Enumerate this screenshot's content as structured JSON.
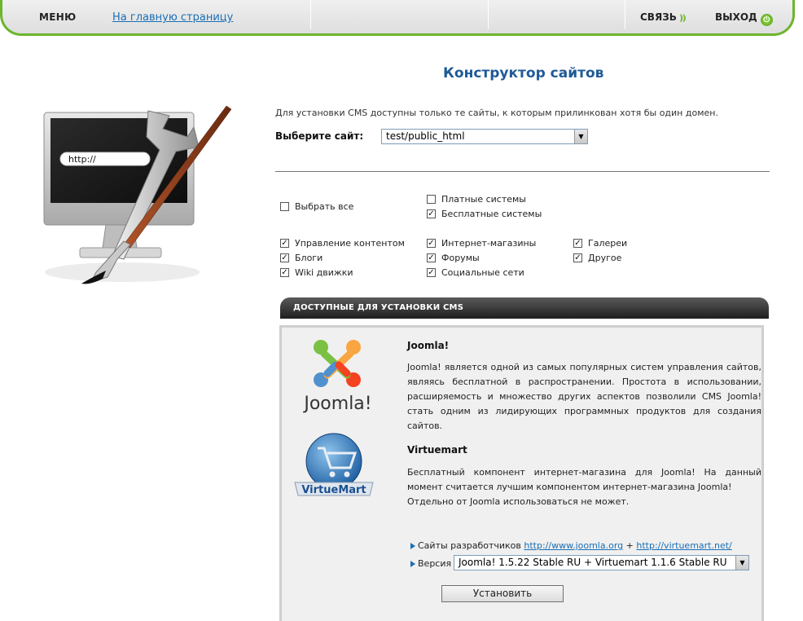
{
  "topbar": {
    "menu_label": "МЕНЮ",
    "home_link": "На главную страницу",
    "contact_label": "СВЯЗЬ",
    "logout_label": "ВЫХОД"
  },
  "page": {
    "title": "Конструктор сайтов",
    "illustration_text": "http://"
  },
  "site_select": {
    "note": "Для установки CMS доступны только те сайты, к которым прилинкован хотя бы один домен.",
    "label": "Выберите сайт:",
    "selected": "test/public_html"
  },
  "filters": {
    "select_all": {
      "label": "Выбрать все",
      "checked": false
    },
    "paid": {
      "label": "Платные системы",
      "checked": false
    },
    "free": {
      "label": "Бесплатные системы",
      "checked": true
    },
    "categories": [
      {
        "label": "Управление контентом",
        "checked": true
      },
      {
        "label": "Блоги",
        "checked": true
      },
      {
        "label": "Wiki движки",
        "checked": true
      },
      {
        "label": "Интернет-магазины",
        "checked": true
      },
      {
        "label": "Форумы",
        "checked": true
      },
      {
        "label": "Социальные сети",
        "checked": true
      },
      {
        "label": "Галереи",
        "checked": true
      },
      {
        "label": "Другое",
        "checked": true
      }
    ]
  },
  "cms": {
    "header": "ДОСТУПНЫЕ ДЛЯ УСТАНОВКИ CMS",
    "items": [
      {
        "name": "Joomla!",
        "logo_text": "Joomla!",
        "description": "Joomla! является одной из самых популярных систем управления сайтов, являясь бесплатной в распространении. Простота в использовании, расширяемость и множество других аспектов позволили CMS Joomla! стать одним из лидирующих программных продуктов для создания сайтов."
      },
      {
        "name": "Virtuemart",
        "logo_text": "VirtueMart",
        "description": "Бесплатный компонент интернет-магазина для Joomla! На данный момент считается лучшим компонентом интернет-магазина Joomla!",
        "note": "Отдельно от Joomla использоваться не может."
      }
    ],
    "dev_sites_label": "Сайты разработчиков",
    "dev_link_1": "http://www.joomla.org",
    "plus": "+",
    "dev_link_2": "http://virtuemart.net/",
    "version_label": "Версия",
    "version_selected": "Joomla! 1.5.22 Stable RU + Virtuemart 1.1.6 Stable RU",
    "install_button": "Установить"
  },
  "colors": {
    "accent_green": "#6cb52d",
    "title_blue": "#1f5a96",
    "link_blue": "#1a6fb5"
  }
}
